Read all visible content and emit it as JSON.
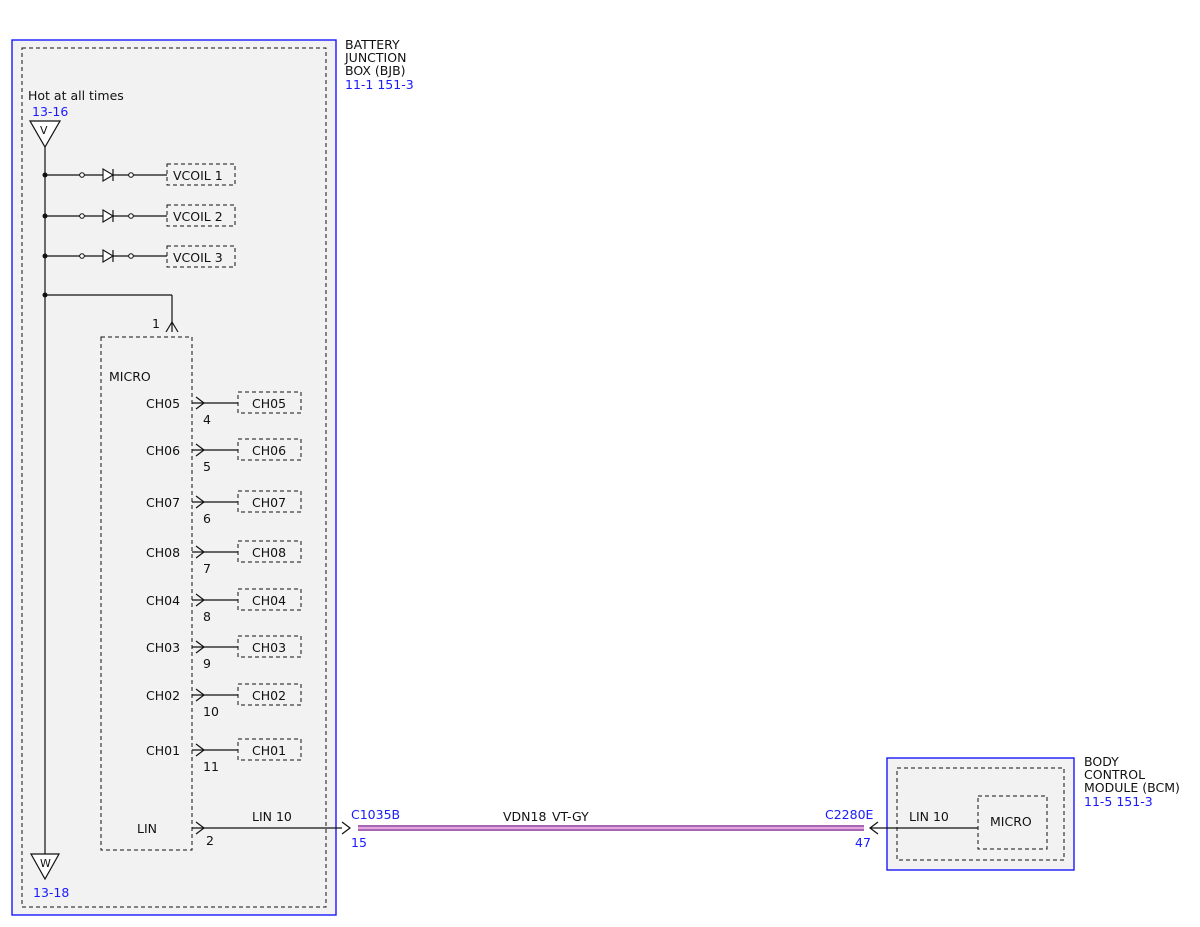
{
  "bjb": {
    "name_lines": [
      "BATTERY",
      "JUNCTION",
      "BOX (BJB)"
    ],
    "refs": "11-1  151-3",
    "hot_label": "Hot at all times",
    "hot_ref": "13-16",
    "hot_symbol": "V",
    "ground_symbol": "W",
    "ground_ref": "13-18",
    "vcoils": [
      "VCOIL 1",
      "VCOIL 2",
      "VCOIL 3"
    ],
    "micro_label": "MICRO",
    "micro_power_pin": "1",
    "channels": [
      {
        "label": "CH05",
        "pin": "4",
        "load": "CH05"
      },
      {
        "label": "CH06",
        "pin": "5",
        "load": "CH06"
      },
      {
        "label": "CH07",
        "pin": "6",
        "load": "CH07"
      },
      {
        "label": "CH08",
        "pin": "7",
        "load": "CH08"
      },
      {
        "label": "CH04",
        "pin": "8",
        "load": "CH04"
      },
      {
        "label": "CH03",
        "pin": "9",
        "load": "CH03"
      },
      {
        "label": "CH02",
        "pin": "10",
        "load": "CH02"
      },
      {
        "label": "CH01",
        "pin": "11",
        "load": "CH01"
      }
    ],
    "lin_label": "LIN",
    "lin_pin": "2",
    "lin_net": "LIN 10"
  },
  "harness": {
    "connector_left": "C1035B",
    "connector_left_pin": "15",
    "circuit": "VDN18",
    "color": "VT-GY",
    "connector_right": "C2280E",
    "connector_right_pin": "47",
    "wire_colors": {
      "base": "#a566b5",
      "stripe": "#e8a4dc"
    }
  },
  "bcm": {
    "name_lines": [
      "BODY",
      "CONTROL",
      "MODULE (BCM)"
    ],
    "refs": "11-5  151-3",
    "lin_net": "LIN 10",
    "micro_label": "MICRO"
  },
  "colors": {
    "ref_blue": "#1a1aff",
    "box_fill": "#f2f2f2"
  }
}
